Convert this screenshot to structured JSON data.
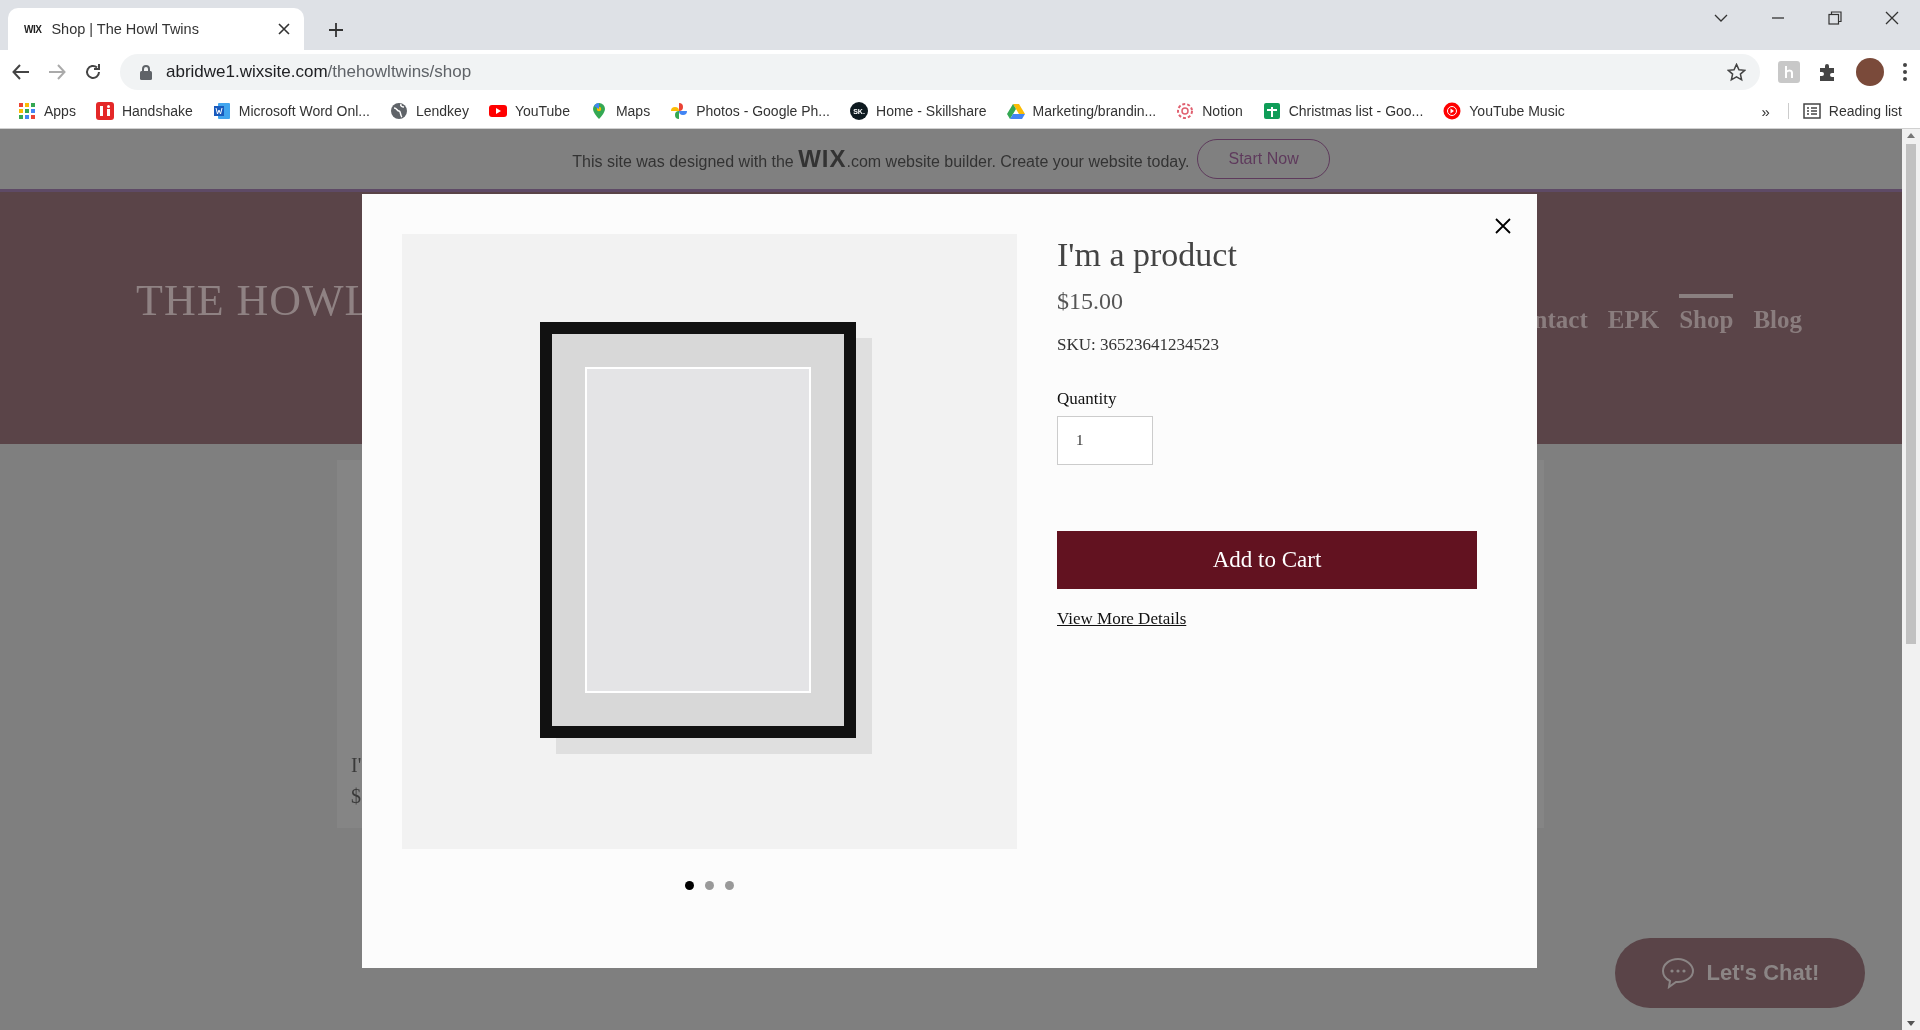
{
  "browser": {
    "tabs": [
      {
        "favicon_text": "WIX",
        "title": "Shop | The Howl Twins",
        "selected": true
      }
    ],
    "address": {
      "domain": "abridwe1.wixsite.com",
      "path": "/thehowltwins/shop"
    },
    "bookmarks": [
      {
        "kind": "apps",
        "label": "Apps"
      },
      {
        "kind": "handshake",
        "label": "Handshake"
      },
      {
        "kind": "word",
        "label": "Microsoft Word Onl..."
      },
      {
        "kind": "globe",
        "label": "Lendkey"
      },
      {
        "kind": "youtube",
        "label": "YouTube"
      },
      {
        "kind": "maps",
        "label": "Maps"
      },
      {
        "kind": "photos",
        "label": "Photos - Google Ph..."
      },
      {
        "kind": "skillshare",
        "badge": "SK.",
        "label": "Home - Skillshare"
      },
      {
        "kind": "drive",
        "label": "Marketing/brandin..."
      },
      {
        "kind": "notion",
        "label": "Notion"
      },
      {
        "kind": "sheets",
        "label": "Christmas list - Goo..."
      },
      {
        "kind": "ytmusic",
        "label": "YouTube Music"
      }
    ],
    "overflow": "»",
    "reading_list": "Reading list"
  },
  "wix_banner": {
    "text": "This site was designed with the **WIX**.com website builder. Create your website today.",
    "button": "Start Now"
  },
  "site_header": {
    "logo": "THE HOWL",
    "nav": [
      {
        "label": "ntact",
        "selected": false
      },
      {
        "label": "EPK",
        "selected": false
      },
      {
        "label": "Shop",
        "selected": true
      },
      {
        "label": "Blog",
        "selected": false
      }
    ]
  },
  "background_product": {
    "title": "I'",
    "price": "$"
  },
  "quick_view": {
    "title": "I'm a product",
    "price": "$15.00",
    "sku": "SKU: 36523641234523",
    "quantity_label": "Quantity",
    "quantity": "1",
    "add_button": "Add to Cart",
    "details_link": "View More Details",
    "slides": [
      {
        "selected": true
      },
      {
        "selected": false
      },
      {
        "selected": false
      }
    ]
  },
  "chat_button": "Let's Chat!"
}
